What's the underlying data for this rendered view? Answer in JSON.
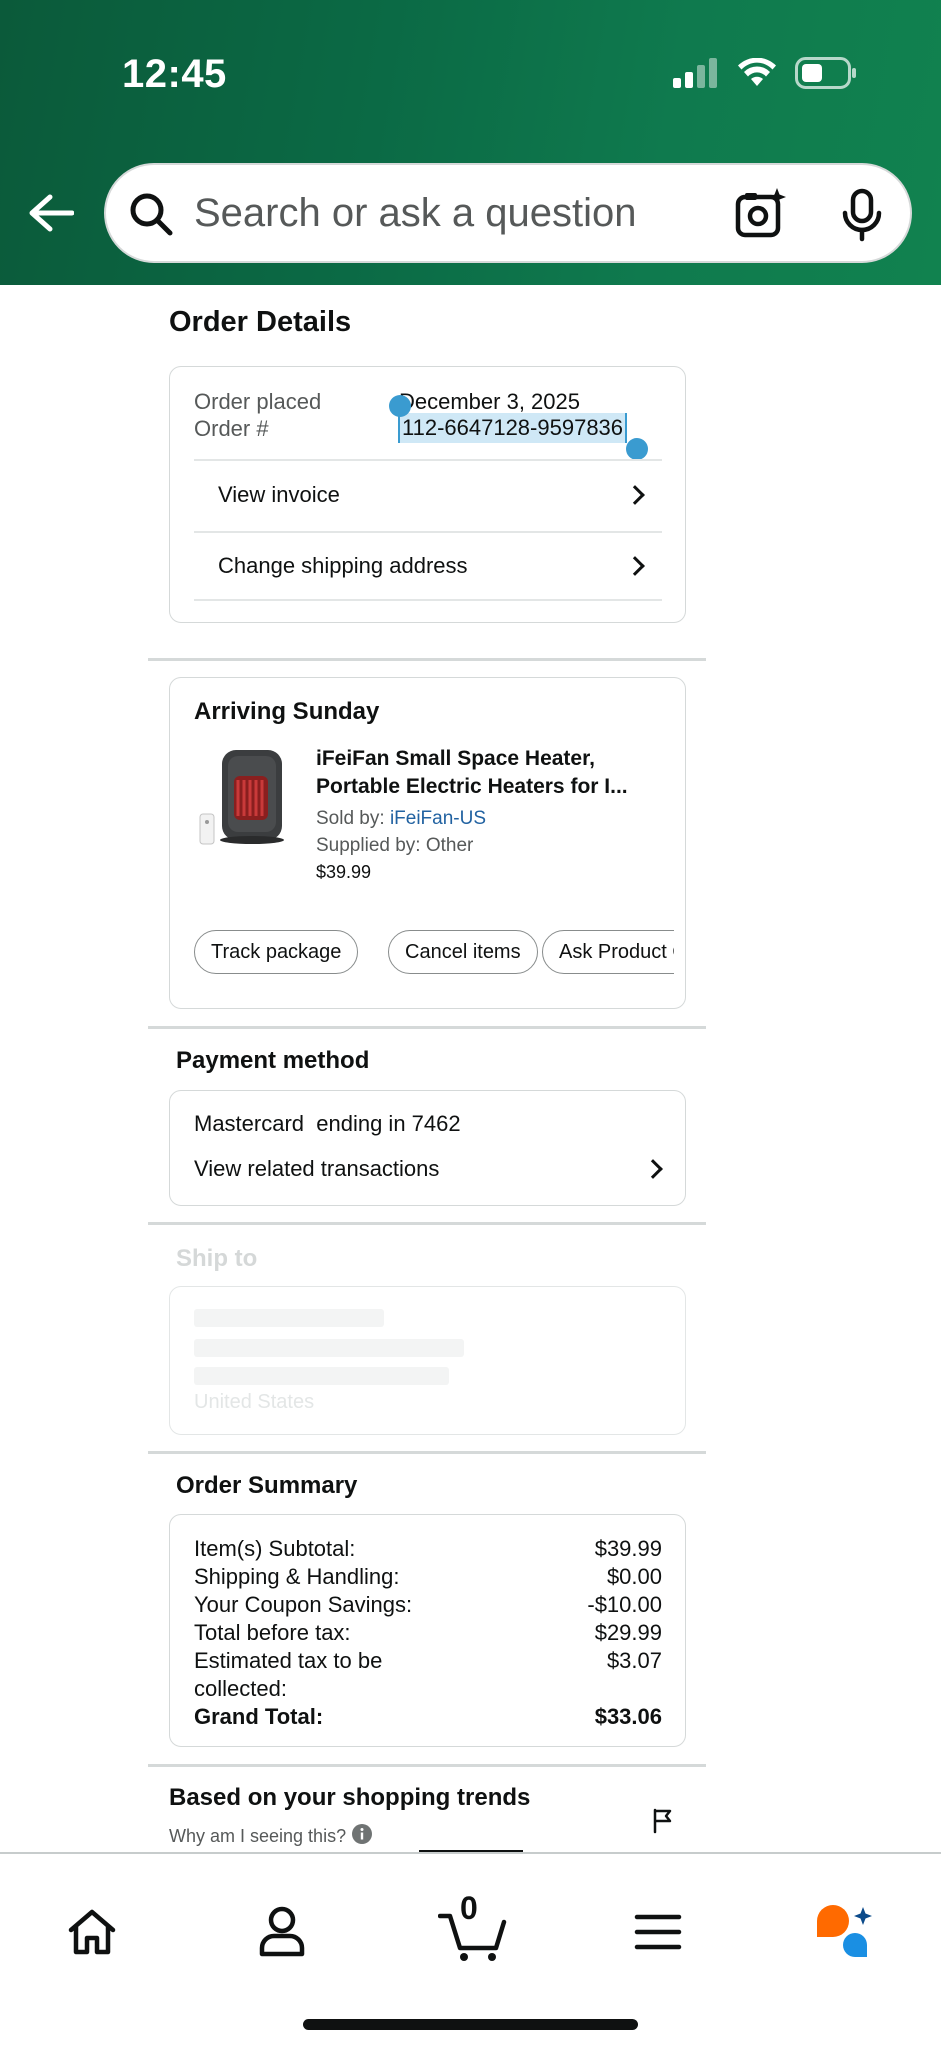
{
  "status_bar": {
    "time": "12:45"
  },
  "search": {
    "placeholder": "Search or ask a question"
  },
  "order_details": {
    "title": "Order Details",
    "order_placed_label": "Order placed",
    "order_placed_value": "December 3, 2025",
    "order_number_label": "Order #",
    "order_number_value": "112-6647128-9597836",
    "links": [
      "View invoice",
      "Change shipping address"
    ]
  },
  "shipment": {
    "heading": "Arriving Sunday",
    "product_title_line1": "iFeiFan Small Space Heater,",
    "product_title_line2": "Portable Electric Heaters for I...",
    "sold_by_label": "Sold by:",
    "sold_by_value": "iFeiFan-US",
    "supplied_by": "Supplied by: Other",
    "price": "$39.99",
    "actions": [
      "Track package",
      "Cancel items",
      "Ask Product Qu"
    ]
  },
  "payment": {
    "title": "Payment method",
    "card_text": "Mastercard  ending in 7462",
    "transactions_link": "View related transactions"
  },
  "ship_to": {
    "title": "Ship to",
    "country": "United States"
  },
  "order_summary": {
    "title": "Order Summary",
    "rows": [
      {
        "label": "Item(s) Subtotal:",
        "value": "$39.99"
      },
      {
        "label": "Shipping & Handling:",
        "value": "$0.00"
      },
      {
        "label": "Your Coupon Savings:",
        "value": "-$10.00"
      },
      {
        "label": "Total before tax:",
        "value": "$29.99"
      },
      {
        "label": "Estimated tax to be collected:",
        "value": "$3.07"
      }
    ],
    "grand_total_label": "Grand Total:",
    "grand_total_value": "$33.06"
  },
  "recommendations": {
    "title": "Based on your shopping trends",
    "why_link": "Why am I seeing this?"
  },
  "bottom_nav": {
    "cart_count": "0",
    "items": [
      "home-icon",
      "account-icon",
      "cart-icon",
      "menu-icon",
      "rufus-ai-icon"
    ]
  },
  "colors": {
    "header_green": "#0b6a45",
    "link_blue": "#2162a1",
    "selection_blue": "#3a9bd0",
    "rufus_orange": "#ff6a00",
    "rufus_blue": "#1a8fe3"
  }
}
